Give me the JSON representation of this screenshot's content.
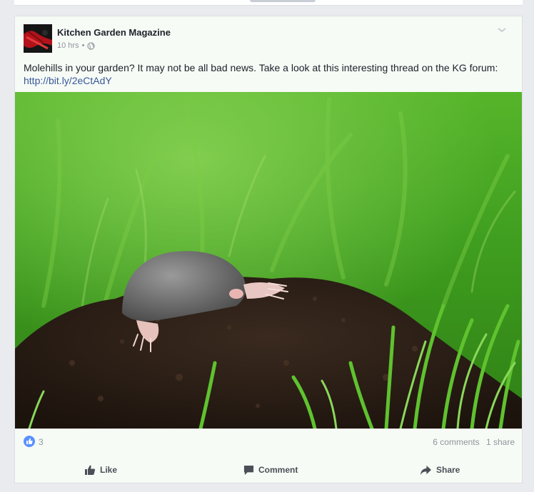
{
  "post": {
    "author": "Kitchen Garden Magazine",
    "time": "10 hrs",
    "separator": "•",
    "privacy_icon": "globe-icon",
    "options_icon": "chevron-down-icon",
    "text": "Molehills in your garden? It may not be all bad news. Take a look at this interesting thread on the KG forum:",
    "link": "http://bit.ly/2eCtAdY"
  },
  "stats": {
    "likes": "3",
    "comments": "6 comments",
    "shares": "1 share"
  },
  "actions": {
    "like": "Like",
    "comment": "Comment",
    "share": "Share"
  },
  "colors": {
    "link": "#365899",
    "like_blue": "#5890ff",
    "muted": "#90949c",
    "page_bg": "#e9ebee"
  }
}
